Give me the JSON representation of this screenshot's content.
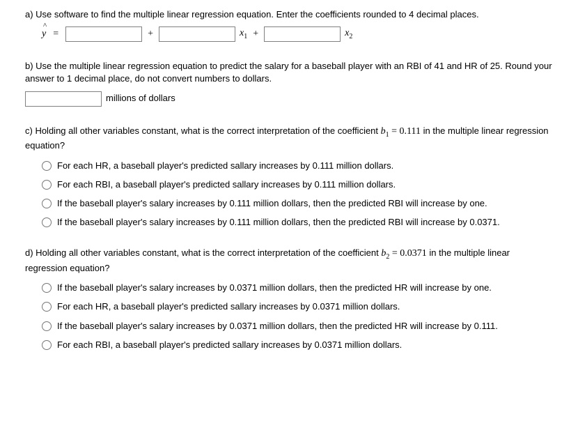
{
  "a": {
    "prompt": "a) Use software to find the multiple linear regression equation. Enter the coefficients rounded to 4 decimal places.",
    "yhat": "ŷ",
    "eq": "=",
    "plus1": "+",
    "x1": "x",
    "x1sub": "1",
    "plus2": "+",
    "x2": "x",
    "x2sub": "2"
  },
  "b": {
    "prompt": "b) Use the multiple linear regression equation to predict the salary for a baseball player with an RBI of 41 and HR of 25. Round your answer to 1 decimal place, do not convert numbers to dollars.",
    "unit": "millions of dollars"
  },
  "c": {
    "prompt_pre": "c) Holding all other variables constant, what is the correct interpretation of the coefficient ",
    "coef_var": "b",
    "coef_sub": "1",
    "coef_eq": " = 0.111",
    "prompt_post": " in the multiple linear regression equation?",
    "options": [
      "For each HR, a baseball player's predicted sallary increases by 0.111 million dollars.",
      "For each RBI, a baseball player's predicted sallary increases by 0.111 million dollars.",
      "If the baseball player's salary increases by 0.111 million dollars, then the predicted RBI will increase by one.",
      "If the baseball player's salary increases by 0.111 million dollars, then the predicted RBI will increase by 0.0371."
    ]
  },
  "d": {
    "prompt_pre": "d) Holding all other variables constant, what is the correct interpretation of the coefficient ",
    "coef_var": "b",
    "coef_sub": "2",
    "coef_eq": " = 0.0371",
    "prompt_post": " in the multiple linear regression equation?",
    "options": [
      "If the baseball player's salary increases by 0.0371 million dollars, then the predicted HR will increase by one.",
      "For each HR, a baseball player's predicted sallary increases by 0.0371 million dollars.",
      "If the baseball player's salary increases by 0.0371 million dollars, then the predicted HR will increase by 0.111.",
      "For each RBI, a baseball player's predicted sallary increases by 0.0371 million dollars."
    ]
  }
}
